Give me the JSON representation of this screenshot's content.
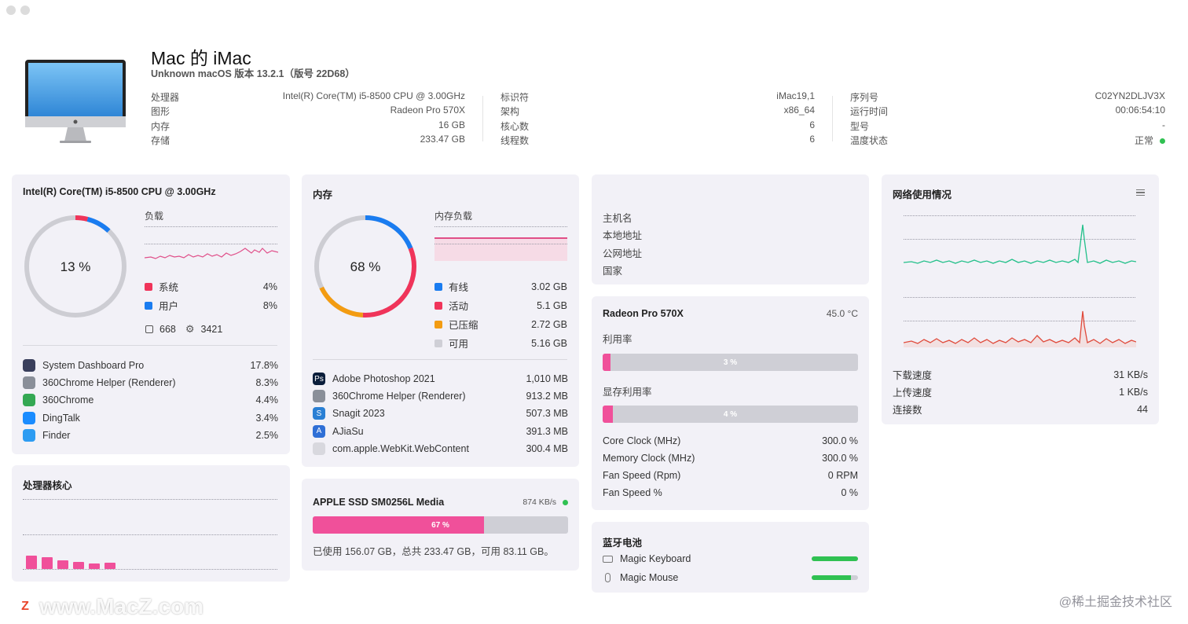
{
  "header": {
    "title": "Mac 的 iMac",
    "subtitle": "Unknown macOS 版本 13.2.1（版号 22D68）",
    "col1": [
      {
        "k": "处理器",
        "v": "Intel(R) Core(TM) i5-8500 CPU @ 3.00GHz"
      },
      {
        "k": "图形",
        "v": "Radeon Pro 570X"
      },
      {
        "k": "内存",
        "v": "16 GB"
      },
      {
        "k": "存储",
        "v": "233.47 GB"
      }
    ],
    "col2": [
      {
        "k": "标识符",
        "v": "iMac19,1"
      },
      {
        "k": "架构",
        "v": "x86_64"
      },
      {
        "k": "核心数",
        "v": "6"
      },
      {
        "k": "线程数",
        "v": "6"
      }
    ],
    "col3": [
      {
        "k": "序列号",
        "v": "C02YN2DLJV3X"
      },
      {
        "k": "运行时间",
        "v": "00:06:54:10"
      },
      {
        "k": "型号",
        "v": "-"
      },
      {
        "k": "温度状态",
        "v": "正常"
      }
    ]
  },
  "cpu": {
    "title": "Intel(R) Core(TM) i5-8500 CPU @ 3.00GHz",
    "gauge_text": "13 %",
    "load_label": "负载",
    "legend": [
      {
        "label": "系统",
        "value": "4%",
        "color": "#f0345a"
      },
      {
        "label": "用户",
        "value": "8%",
        "color": "#1a7cf0"
      }
    ],
    "ring": [
      {
        "name": "系统",
        "fraction": 0.04,
        "color": "#f0345a"
      },
      {
        "name": "用户",
        "fraction": 0.08,
        "color": "#1a7cf0"
      }
    ],
    "threads": "668",
    "processes": "3421",
    "top": [
      {
        "name": "System Dashboard Pro",
        "value": "17.8%",
        "icon": "dashboard-icon",
        "color": "#3a3f5c"
      },
      {
        "name": "360Chrome Helper (Renderer)",
        "value": "8.3%",
        "icon": "helper-icon",
        "color": "#8a8f99"
      },
      {
        "name": "360Chrome",
        "value": "4.4%",
        "icon": "chrome-icon",
        "color": "#34a853"
      },
      {
        "name": "DingTalk",
        "value": "3.4%",
        "icon": "dingtalk-icon",
        "color": "#1a8cff"
      },
      {
        "name": "Finder",
        "value": "2.5%",
        "icon": "finder-icon",
        "color": "#2d9cf2"
      }
    ]
  },
  "cores": {
    "title": "处理器核心",
    "values": [
      0.95,
      0.85,
      0.62,
      0.48,
      0.4,
      0.45
    ],
    "color": "#f0509a"
  },
  "memory": {
    "title": "内存",
    "gauge_text": "68 %",
    "load_label": "内存负载",
    "legend": [
      {
        "label": "有线",
        "value": "3.02 GB",
        "color": "#1a7cf0"
      },
      {
        "label": "活动",
        "value": "5.1 GB",
        "color": "#f0345a"
      },
      {
        "label": "已压缩",
        "value": "2.72 GB",
        "color": "#f39c12"
      },
      {
        "label": "可用",
        "value": "5.16 GB",
        "color": "#cfcfd6"
      }
    ],
    "ring": [
      {
        "name": "有线",
        "fraction": 0.189,
        "color": "#1a7cf0"
      },
      {
        "name": "活动",
        "fraction": 0.319,
        "color": "#f0345a"
      },
      {
        "name": "已压缩",
        "fraction": 0.17,
        "color": "#f39c12"
      }
    ],
    "top": [
      {
        "name": "Adobe Photoshop 2021",
        "value": "1,010 MB",
        "icon": "photoshop-icon",
        "color": "#0b1e3b",
        "glyph": "Ps"
      },
      {
        "name": "360Chrome Helper (Renderer)",
        "value": "913.2 MB",
        "icon": "helper-icon",
        "color": "#8a8f99",
        "glyph": ""
      },
      {
        "name": "Snagit 2023",
        "value": "507.3 MB",
        "icon": "snagit-icon",
        "color": "#2a7fd4",
        "glyph": "S"
      },
      {
        "name": "AJiaSu",
        "value": "391.3 MB",
        "icon": "ajiasu-icon",
        "color": "#2f6fd6",
        "glyph": "A"
      },
      {
        "name": "com.apple.WebKit.WebContent",
        "value": "300.4 MB",
        "icon": "webkit-icon",
        "color": "#d8d8de",
        "glyph": ""
      }
    ]
  },
  "disk": {
    "title": "APPLE SSD SM0256L Media",
    "speed": "874 KB/s",
    "percent_text": "67 %",
    "fraction": 0.67,
    "usage_text": "已使用 156.07 GB，总共 233.47 GB，可用 83.11 GB。"
  },
  "network_info": {
    "rows": [
      "主机名",
      "本地地址",
      "公网地址",
      "国家"
    ]
  },
  "gpu": {
    "title": "Radeon Pro 570X",
    "temp": "45.0 °C",
    "util_label": "利用率",
    "util_text": "3 %",
    "util_fraction": 0.03,
    "vram_label": "显存利用率",
    "vram_text": "4 %",
    "vram_fraction": 0.04,
    "stats": [
      {
        "k": "Core Clock (MHz)",
        "v": "300.0 %"
      },
      {
        "k": "Memory Clock (MHz)",
        "v": "300.0 %"
      },
      {
        "k": "Fan Speed (Rpm)",
        "v": "0 RPM"
      },
      {
        "k": "Fan Speed %",
        "v": "0 %"
      }
    ]
  },
  "bluetooth": {
    "title": "蓝牙电池",
    "devices": [
      {
        "name": "Magic Keyboard",
        "icon": "keyboard-icon",
        "level": 1.0
      },
      {
        "name": "Magic Mouse",
        "icon": "mouse-icon",
        "level": 0.85
      }
    ]
  },
  "net_usage": {
    "title": "网络使用情况",
    "rows": [
      {
        "k": "下载速度",
        "v": "31 KB/s"
      },
      {
        "k": "上传速度",
        "v": "1 KB/s"
      },
      {
        "k": "连接数",
        "v": "44"
      }
    ],
    "download_color": "#23c08a",
    "upload_color": "#e04a3b"
  },
  "watermark": {
    "logo": "Z",
    "text": "www.MacZ.com",
    "credit": "@稀土掘金技术社区"
  }
}
